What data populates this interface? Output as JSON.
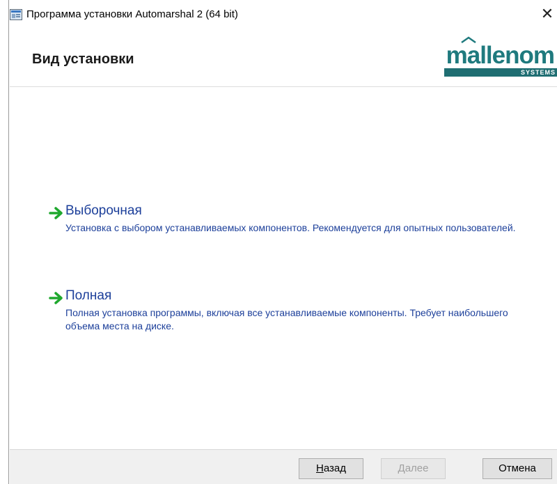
{
  "window": {
    "title": "Программа установки Automarshal 2 (64 bit)",
    "close_glyph": "✕"
  },
  "header": {
    "title": "Вид установки",
    "logo_name": "mallenom",
    "logo_sub": "SYSTEMS"
  },
  "options": [
    {
      "title": "Выборочная",
      "description": "Установка с выбором устанавливаемых компонентов. Рекомендуется для опытных пользователей."
    },
    {
      "title": "Полная",
      "description": "Полная установка программы, включая все устанавливаемые компоненты. Требует наибольшего объема места на диске."
    }
  ],
  "footer": {
    "back_label": "Назад",
    "next_label": "Далее",
    "cancel_label": "Отмена"
  },
  "colors": {
    "option_text": "#1c3f9a",
    "arrow_green": "#1fa82e",
    "brand_teal": "#1f7a7e"
  }
}
